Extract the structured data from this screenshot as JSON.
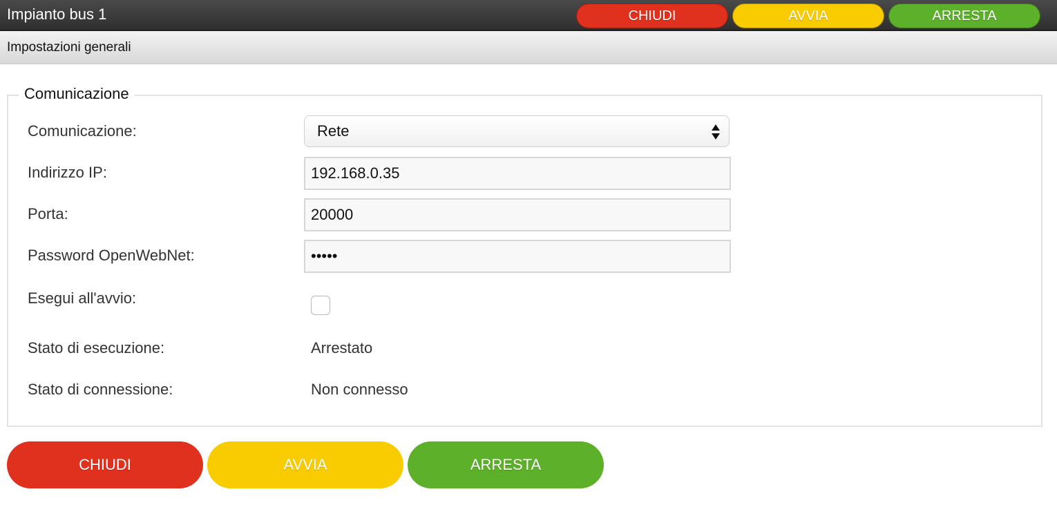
{
  "app": {
    "title": "Impianto bus 1"
  },
  "toolbar": {
    "close_label": "CHIUDI",
    "start_label": "AVVIA",
    "stop_label": "ARRESTA"
  },
  "section": {
    "title": "Impostazioni generali"
  },
  "communication": {
    "legend": "Comunicazione",
    "mode_label": "Comunicazione:",
    "mode_value": "Rete",
    "ip_label": "Indirizzo IP:",
    "ip_value": "192.168.0.35",
    "port_label": "Porta:",
    "port_value": "20000",
    "password_label": "Password OpenWebNet:",
    "password_value": "12345",
    "autostart_label": "Esegui all'avvio:",
    "autostart_checked": false,
    "run_state_label": "Stato di esecuzione:",
    "run_state_value": "Arrestato",
    "connection_state_label": "Stato di connessione:",
    "connection_state_value": "Non connesso"
  },
  "actions": {
    "close_label": "CHIUDI",
    "start_label": "AVVIA",
    "stop_label": "ARRESTA"
  },
  "colors": {
    "close": "#e0301e",
    "start": "#f8cc00",
    "stop": "#5cb02a",
    "topbar": "#3a3a3a"
  },
  "icons": {
    "select_arrows": "up-down-arrows-icon"
  }
}
